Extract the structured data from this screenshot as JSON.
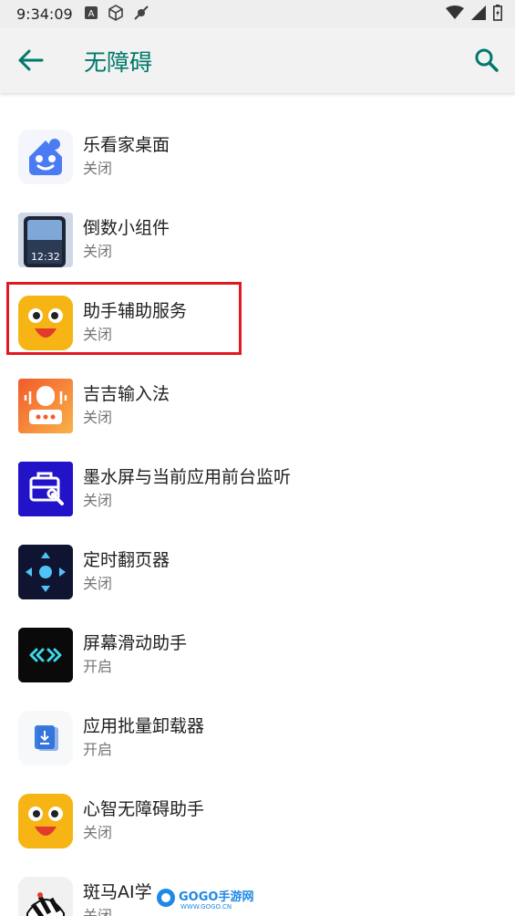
{
  "status_bar": {
    "time": "9:34:09"
  },
  "header": {
    "title": "无障碍"
  },
  "list": {
    "items": [
      {
        "title": "乐看家桌面",
        "status": "关闭"
      },
      {
        "title": "倒数小组件",
        "status": "关闭",
        "icon_text": "12:32"
      },
      {
        "title": "助手辅助服务",
        "status": "关闭"
      },
      {
        "title": "吉吉输入法",
        "status": "关闭"
      },
      {
        "title": "墨水屏与当前应用前台监听",
        "status": "关闭"
      },
      {
        "title": "定时翻页器",
        "status": "关闭"
      },
      {
        "title": "屏幕滑动助手",
        "status": "开启"
      },
      {
        "title": "应用批量卸载器",
        "status": "开启"
      },
      {
        "title": "心智无障碍助手",
        "status": "关闭"
      },
      {
        "title": "斑马AI学",
        "status": "关闭"
      }
    ]
  },
  "watermark": {
    "text": "GOGO手游网",
    "subtext": "WWW.GOGO.CN"
  },
  "colors": {
    "accent": "#00796b",
    "highlight": "#e0191e"
  }
}
